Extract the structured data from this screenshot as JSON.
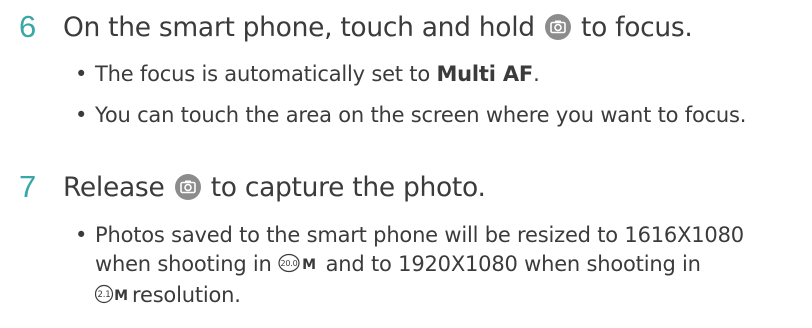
{
  "steps": [
    {
      "number": "6",
      "text_before": "On the smart phone, touch and hold",
      "text_after": "to focus.",
      "icon": "camera-shutter-icon",
      "bullets": [
        {
          "text_before": "The focus is automatically set to",
          "bold": "Multi AF",
          "text_after": "."
        },
        {
          "text": "You can touch the area on the screen where you want to focus."
        }
      ]
    },
    {
      "number": "7",
      "text_before": "Release",
      "text_after": "to capture the photo.",
      "icon": "camera-shutter-icon",
      "bullets": [
        {
          "line1": "Photos saved to the smart phone will be resized to 1616X1080",
          "line2_before": "when shooting in",
          "res1": {
            "value": "20.0",
            "unit": "M",
            "icon": "resolution-20m-icon"
          },
          "line2_after": "and to 1920X1080 when shooting in",
          "res2": {
            "value": "2.1",
            "unit": "M",
            "icon": "resolution-2-1m-icon"
          },
          "line3_after": "resolution."
        }
      ]
    }
  ],
  "bullet_symbol": "•",
  "colors": {
    "step_number": "#3aa6a6",
    "text": "#3b3b3b",
    "icon_bg": "#8c8c8c"
  }
}
